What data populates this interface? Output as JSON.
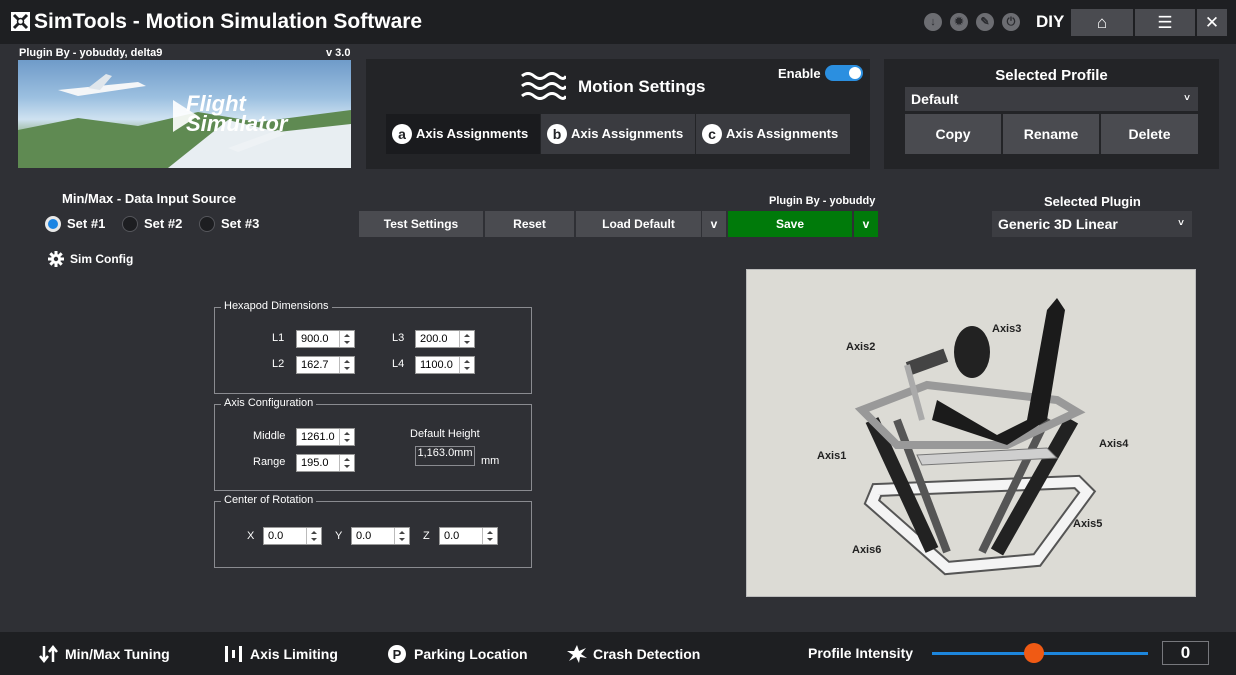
{
  "titlebar": {
    "app_name": "SimTools - Motion Simulation Software",
    "diy": "DIY",
    "icons": [
      "download-icon",
      "gear-badge-icon",
      "wrench-icon",
      "power-icon"
    ],
    "home": "⌂",
    "menu": "☰",
    "close": "✕"
  },
  "plugin": {
    "by_top": "Plugin By - yobuddy, delta9",
    "version": "v 3.0",
    "banner_text": "Flight Simulator",
    "by_mid": "Plugin By - yobuddy"
  },
  "motion": {
    "title": "Motion Settings",
    "enable_label": "Enable",
    "enabled": true,
    "tabs": [
      {
        "badge": "a",
        "label": "Axis Assignments"
      },
      {
        "badge": "b",
        "label": "Axis Assignments"
      },
      {
        "badge": "c",
        "label": "Axis Assignments"
      }
    ]
  },
  "profile": {
    "title": "Selected Profile",
    "selected": "Default",
    "caret": "˅",
    "copy": "Copy",
    "rename": "Rename",
    "delete": "Delete"
  },
  "minmax": {
    "title": "Min/Max - Data Input Source",
    "sets": [
      "Set #1",
      "Set #2",
      "Set #3"
    ],
    "selected_index": 0,
    "sim_config": "Sim Config"
  },
  "actions": {
    "test": "Test Settings",
    "reset": "Reset",
    "load_default": "Load Default",
    "drop": "v",
    "save": "Save"
  },
  "selected_plugin": {
    "title": "Selected Plugin",
    "value": "Generic 3D Linear",
    "caret": "˅"
  },
  "hexapod": {
    "title": "Hexapod Dimensions",
    "l1_label": "L1",
    "l1": "900.0",
    "l2_label": "L2",
    "l2": "162.7",
    "l3_label": "L3",
    "l3": "200.0",
    "l4_label": "L4",
    "l4": "1100.0"
  },
  "axis_config": {
    "title": "Axis Configuration",
    "middle_label": "Middle",
    "middle": "1261.0",
    "range_label": "Range",
    "range": "195.0",
    "default_height_label": "Default Height",
    "default_height": "1,163.0mm",
    "unit": "mm"
  },
  "rotation": {
    "title": "Center of Rotation",
    "x_label": "X",
    "x": "0.0",
    "y_label": "Y",
    "y": "0.0",
    "z_label": "Z",
    "z": "0.0"
  },
  "rig": {
    "axis1": "Axis1",
    "axis2": "Axis2",
    "axis3": "Axis3",
    "axis4": "Axis4",
    "axis5": "Axis5",
    "axis6": "Axis6"
  },
  "bottom": {
    "minmax_tuning": "Min/Max Tuning",
    "axis_limiting": "Axis Limiting",
    "parking": "Parking Location",
    "crash": "Crash Detection",
    "intensity_label": "Profile Intensity",
    "intensity_value": "0",
    "intensity_slider_fraction": 0.47
  },
  "colors": {
    "accent": "#1c85e3",
    "save_green": "#007a0a",
    "slider_thumb": "#f05a14"
  }
}
